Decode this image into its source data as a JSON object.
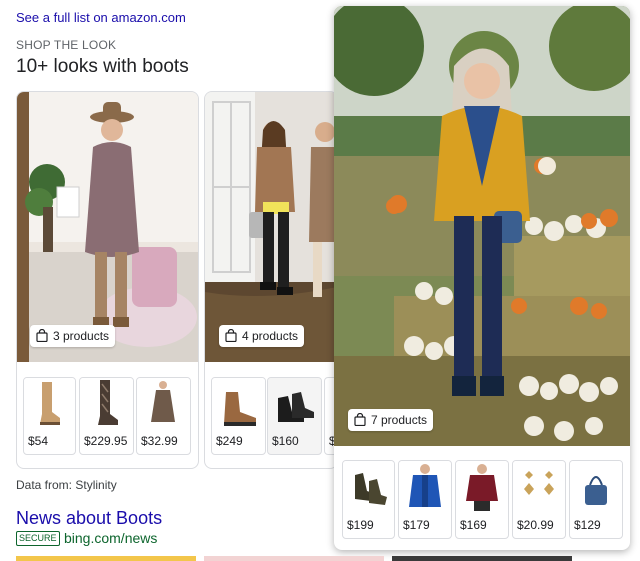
{
  "top_link": "See a full list on amazon.com",
  "section_label": "SHOP THE LOOK",
  "section_title": "10+ looks with boots",
  "looks": [
    {
      "products_label": "3 products",
      "prices": [
        "$54",
        "$229.95",
        "$32.99"
      ]
    },
    {
      "products_label": "4 products",
      "prices": [
        "$249",
        "$160",
        "$"
      ]
    },
    {
      "products_label": "7 products",
      "prices": [
        "$199",
        "$179",
        "$169",
        "$20.99",
        "$129"
      ]
    }
  ],
  "data_source": "Data from: Stylinity",
  "news": {
    "title": "News about Boots",
    "secure_badge": "SECURE",
    "url": "bing.com/news"
  },
  "colors": {
    "link": "#1a0dab",
    "green": "#0d652d",
    "border": "#dadce0"
  }
}
